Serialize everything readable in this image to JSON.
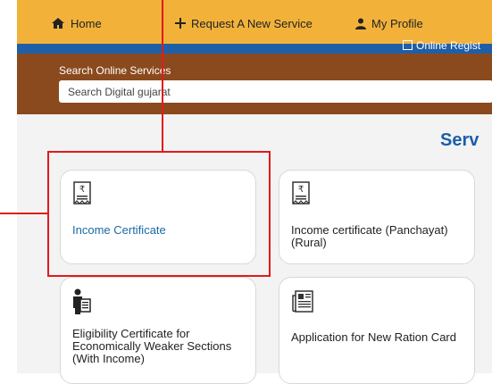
{
  "nav": {
    "home": "Home",
    "request": "Request A New Service",
    "profile": "My Profile"
  },
  "bluebar_cut": "Online Regist",
  "search": {
    "label": "Search Online Services",
    "placeholder": "Search Digital gujarat"
  },
  "section_heading": "Serv",
  "cards": [
    {
      "title": "Income Certificate",
      "icon": "receipt-icon",
      "color": "#1a6aa5"
    },
    {
      "title": "Income certificate (Panchayat) (Rural)",
      "icon": "receipt-icon",
      "color": "#222222"
    },
    {
      "title": "Eligibility Certificate for Economically Weaker Sections (With Income)",
      "icon": "person-document-icon",
      "color": "#222222"
    },
    {
      "title": "Application for New Ration Card",
      "icon": "newspaper-icon",
      "color": "#222222"
    }
  ],
  "colors": {
    "nav_bg": "#f2b23a",
    "blue_bar": "#1f5fa8",
    "search_band": "#8b4a1e",
    "highlight": "#e11b1b"
  }
}
